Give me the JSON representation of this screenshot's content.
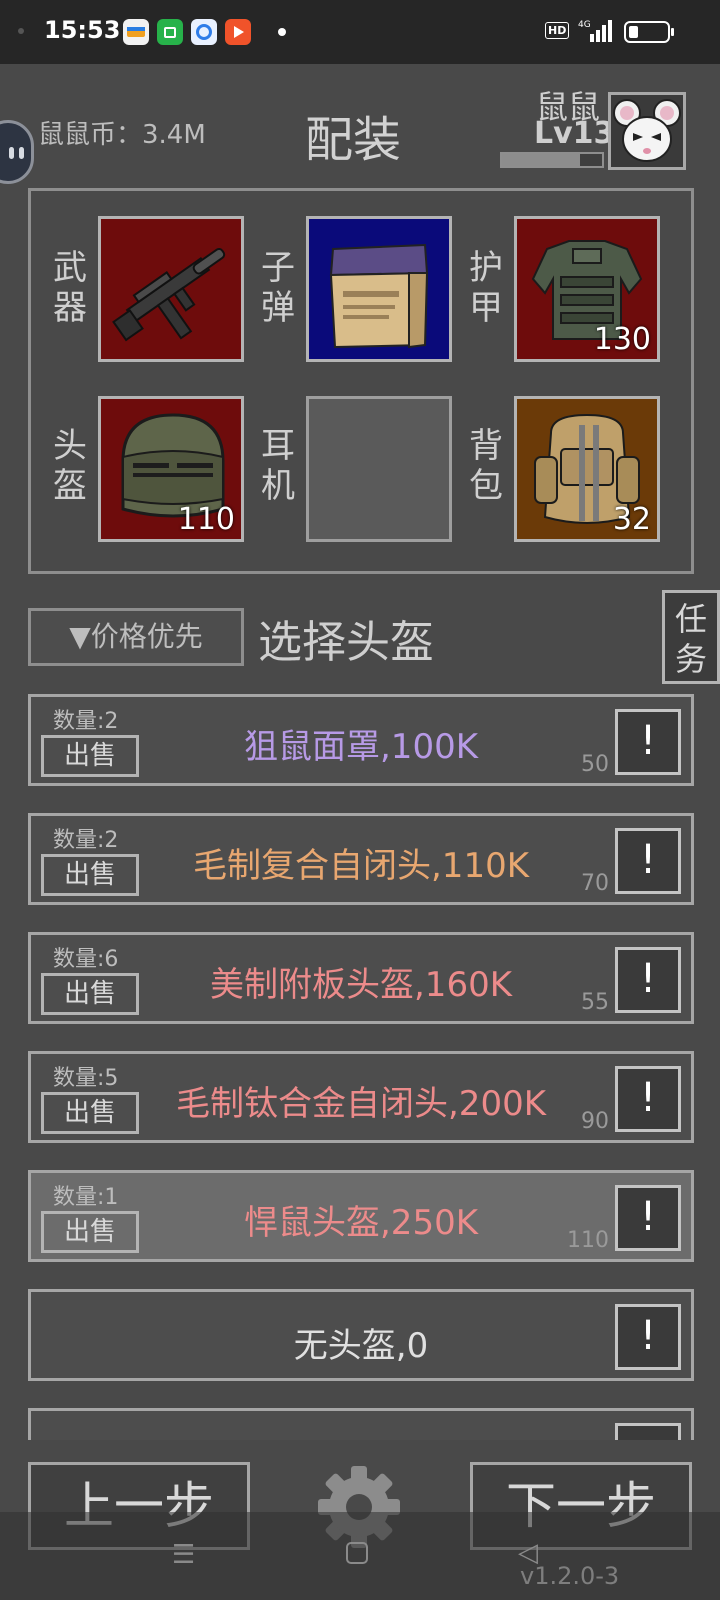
{
  "status_bar": {
    "time": "15:53",
    "hd_label": "HD",
    "network": "4G"
  },
  "header": {
    "coin_text": "鼠鼠币：3.4M",
    "title": "配装",
    "player_name": "鼠鼠",
    "player_level": "Lv13",
    "xp_progress": 0.78
  },
  "equipment": {
    "slots": [
      {
        "label": "武器",
        "item": "rifle",
        "count": ""
      },
      {
        "label": "子弹",
        "item": "ammo-box",
        "count": ""
      },
      {
        "label": "护甲",
        "item": "body-armor",
        "count": "130"
      },
      {
        "label": "头盔",
        "item": "helmet",
        "count": "110"
      },
      {
        "label": "耳机",
        "item": "empty",
        "count": ""
      },
      {
        "label": "背包",
        "item": "backpack",
        "count": "32"
      }
    ]
  },
  "sort_button": "▼价格优先",
  "section_title": "选择头盔",
  "task_button": "任务",
  "items": [
    {
      "qty": "数量:2",
      "sell": "出售",
      "name": "狙鼠面罩,100K",
      "stat": "50",
      "color": "#b79ae6"
    },
    {
      "qty": "数量:2",
      "sell": "出售",
      "name": "毛制复合自闭头,110K",
      "stat": "70",
      "color": "#e8a770"
    },
    {
      "qty": "数量:6",
      "sell": "出售",
      "name": "美制附板头盔,160K",
      "stat": "55",
      "color": "#ec8b8b"
    },
    {
      "qty": "数量:5",
      "sell": "出售",
      "name": "毛制钛合金自闭头,200K",
      "stat": "90",
      "color": "#ec8b8b"
    },
    {
      "qty": "数量:1",
      "sell": "出售",
      "name": "悍鼠头盔,250K",
      "stat": "110",
      "color": "#ec8b8b"
    },
    {
      "name": "无头盔,0",
      "color": "#e0e0e0"
    }
  ],
  "info_label": "!",
  "bottom": {
    "prev": "上一步",
    "next": "下一步",
    "version": "v1.2.0-3"
  }
}
